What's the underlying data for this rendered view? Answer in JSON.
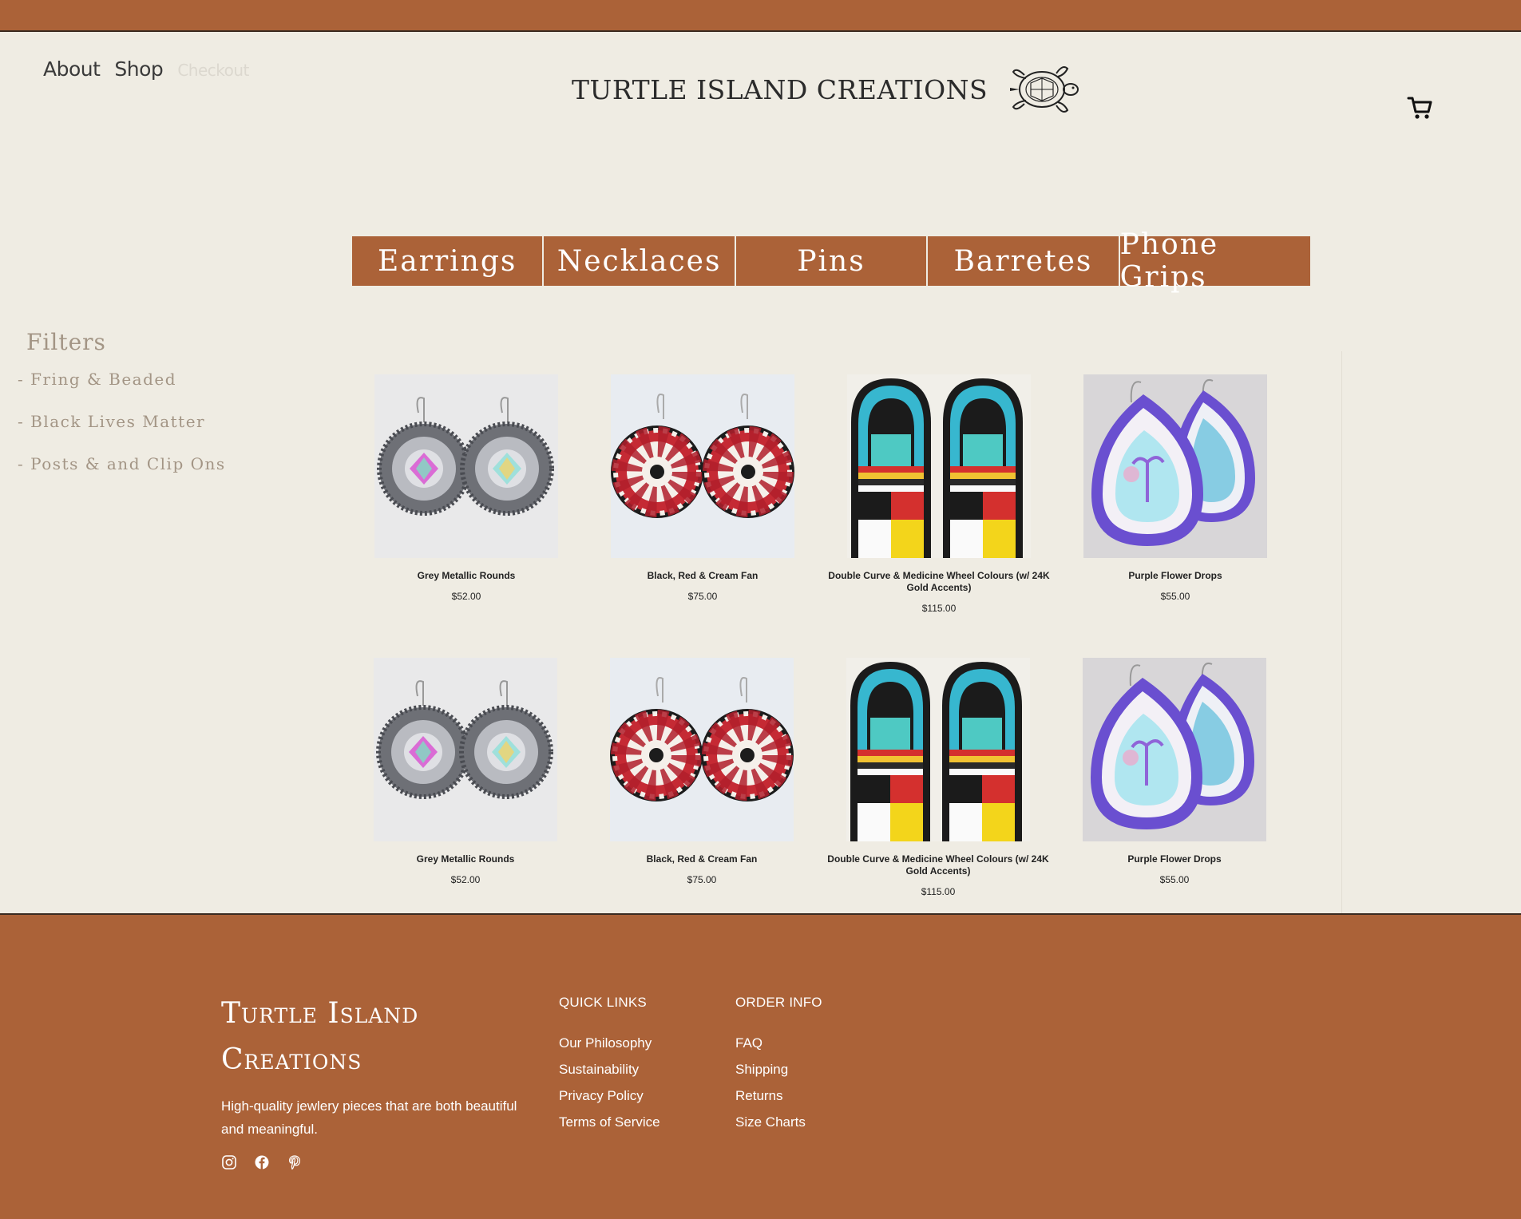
{
  "header": {
    "nav": [
      {
        "label": "About"
      },
      {
        "label": "Shop"
      },
      {
        "label": "Checkout"
      }
    ],
    "brand": "TURTLE ISLAND CREATIONS",
    "cart_icon": "cart-icon"
  },
  "categories": [
    "Earrings",
    "Necklaces",
    "Pins",
    "Barretes",
    "Phone Grips"
  ],
  "filters": {
    "title": "Filters",
    "items": [
      "- Fring & Beaded",
      "- Black Lives Matter",
      "- Posts & and Clip Ons"
    ]
  },
  "products": [
    {
      "name": "Grey Metallic Rounds",
      "price": "$52.00",
      "style": "grey"
    },
    {
      "name": "Black, Red & Cream Fan",
      "price": "$75.00",
      "style": "fan"
    },
    {
      "name": "Double Curve & Medicine Wheel Colours (w/ 24K Gold Accents)",
      "price": "$115.00",
      "style": "stripes"
    },
    {
      "name": "Purple Flower Drops",
      "price": "$55.00",
      "style": "purple"
    },
    {
      "name": "Grey Metallic Rounds",
      "price": "$52.00",
      "style": "grey"
    },
    {
      "name": "Black, Red & Cream Fan",
      "price": "$75.00",
      "style": "fan"
    },
    {
      "name": "Double Curve & Medicine Wheel Colours (w/ 24K Gold Accents)",
      "price": "$115.00",
      "style": "stripes"
    },
    {
      "name": "Purple Flower Drops",
      "price": "$55.00",
      "style": "purple"
    }
  ],
  "footer": {
    "brand": "Turtle Island Creations",
    "description": "High-quality jewlery pieces that are both beautiful and meaningful.",
    "quick_links": {
      "title": "QUICK LINKS",
      "items": [
        "Our Philosophy",
        "Sustainability",
        "Privacy Policy",
        "Terms of Service"
      ]
    },
    "order_info": {
      "title": "ORDER INFO",
      "items": [
        "FAQ",
        "Shipping",
        "Returns",
        "Size Charts"
      ]
    },
    "social": [
      "instagram-icon",
      "facebook-icon",
      "pinterest-icon"
    ]
  },
  "colors": {
    "accent": "#ab6238",
    "background": "#efece3",
    "filter_text": "#a39585"
  }
}
